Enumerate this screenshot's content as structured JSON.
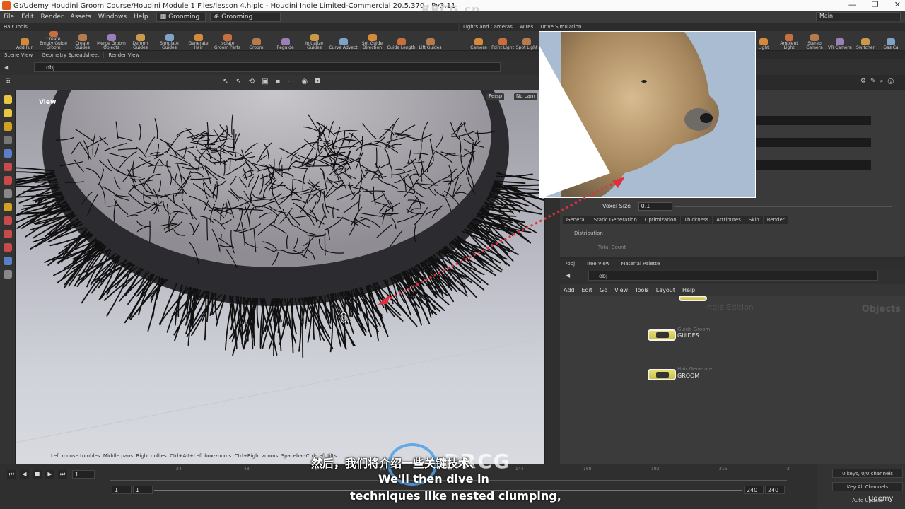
{
  "window": {
    "title": "G:/Udemy Houdini Groom Course/Houdini Module 1 Files/lesson 4.hiplc - Houdini Indie Limited-Commercial 20.5.370 - Py3.11",
    "watermark": "RRCG.cn"
  },
  "menubar": {
    "items": [
      "File",
      "Edit",
      "Render",
      "Assets",
      "Windows",
      "Help"
    ],
    "desktop1": "Grooming",
    "desktop2": "Grooming",
    "main": "Main"
  },
  "shelf": {
    "tab": "Hair Tools",
    "tools": [
      "Add Fur",
      "Create Empty Guide Groom",
      "Create Guides",
      "Merge Groom Objects",
      "Deform Guides",
      "Simulate Guides",
      "Generate Hair",
      "Isolate Groom Parts",
      "Groom",
      "Reguide",
      "Initialize Guides",
      "Curve Advect",
      "Set Guide Direction",
      "Guide Length",
      "Lift Guides"
    ],
    "right_tabs": [
      "Lights and Cameras",
      "Wires",
      "Drive Simulation"
    ],
    "right_tools": [
      "Camera",
      "Point Light",
      "Spot Light"
    ],
    "far_right_tools": [
      "Light",
      "Ambient Light",
      "Stereo Camera",
      "VR Camera",
      "Switcher",
      "Gas Ca"
    ]
  },
  "panel_tabs": [
    "Scene View",
    "Geometry Spreadsheet",
    "Render View"
  ],
  "path": "obj",
  "viewport": {
    "label": "View",
    "persp": "Persp",
    "cam": "No cam",
    "hint": "Left mouse tumbles. Middle pans. Right dollies. Ctrl+Alt+Left box-zooms. Ctrl+Right zooms. Spacebar-Ctrl-Left tilts."
  },
  "params": {
    "voxel_label": "Voxel Size",
    "voxel_value": "0.1",
    "tabs": [
      "General",
      "Static Generation",
      "Optimization",
      "Thickness",
      "Attributes",
      "Skin",
      "Render"
    ],
    "section": "Distribution",
    "total_count_label": "Total Count"
  },
  "network": {
    "tabs": [
      "/obj",
      "Tree View",
      "Material Palette"
    ],
    "path": "obj",
    "menu": [
      "Add",
      "Edit",
      "Go",
      "View",
      "Tools",
      "Layout",
      "Help"
    ],
    "watermark_objects": "Objects",
    "watermark_indie": "Indie Edition",
    "nodes": [
      {
        "type": "Guide Groom",
        "name": "GUIDES"
      },
      {
        "type": "Hair Generate",
        "name": "GROOM"
      }
    ]
  },
  "playbar": {
    "frame": "1",
    "start": "1",
    "start2": "1",
    "end": "240",
    "end2": "240",
    "ticks": [
      "24",
      "48",
      "72",
      "96",
      "120",
      "144",
      "168",
      "192",
      "216",
      "2"
    ],
    "keys": "0 keys, 0/0 channels",
    "key_all": "Key All Channels",
    "auto_update": "Auto Update"
  },
  "subtitles": {
    "cn": "然后，我们将介绍一些关键技术、",
    "en1": "We'll then dive in",
    "en2": "techniques like nested clumping,"
  },
  "branding": {
    "center": "RRCG",
    "udemy": "Udemy"
  },
  "colors": {
    "accent": "#e25b1b",
    "node": "#e0d85c",
    "arrow": "#e03040"
  }
}
